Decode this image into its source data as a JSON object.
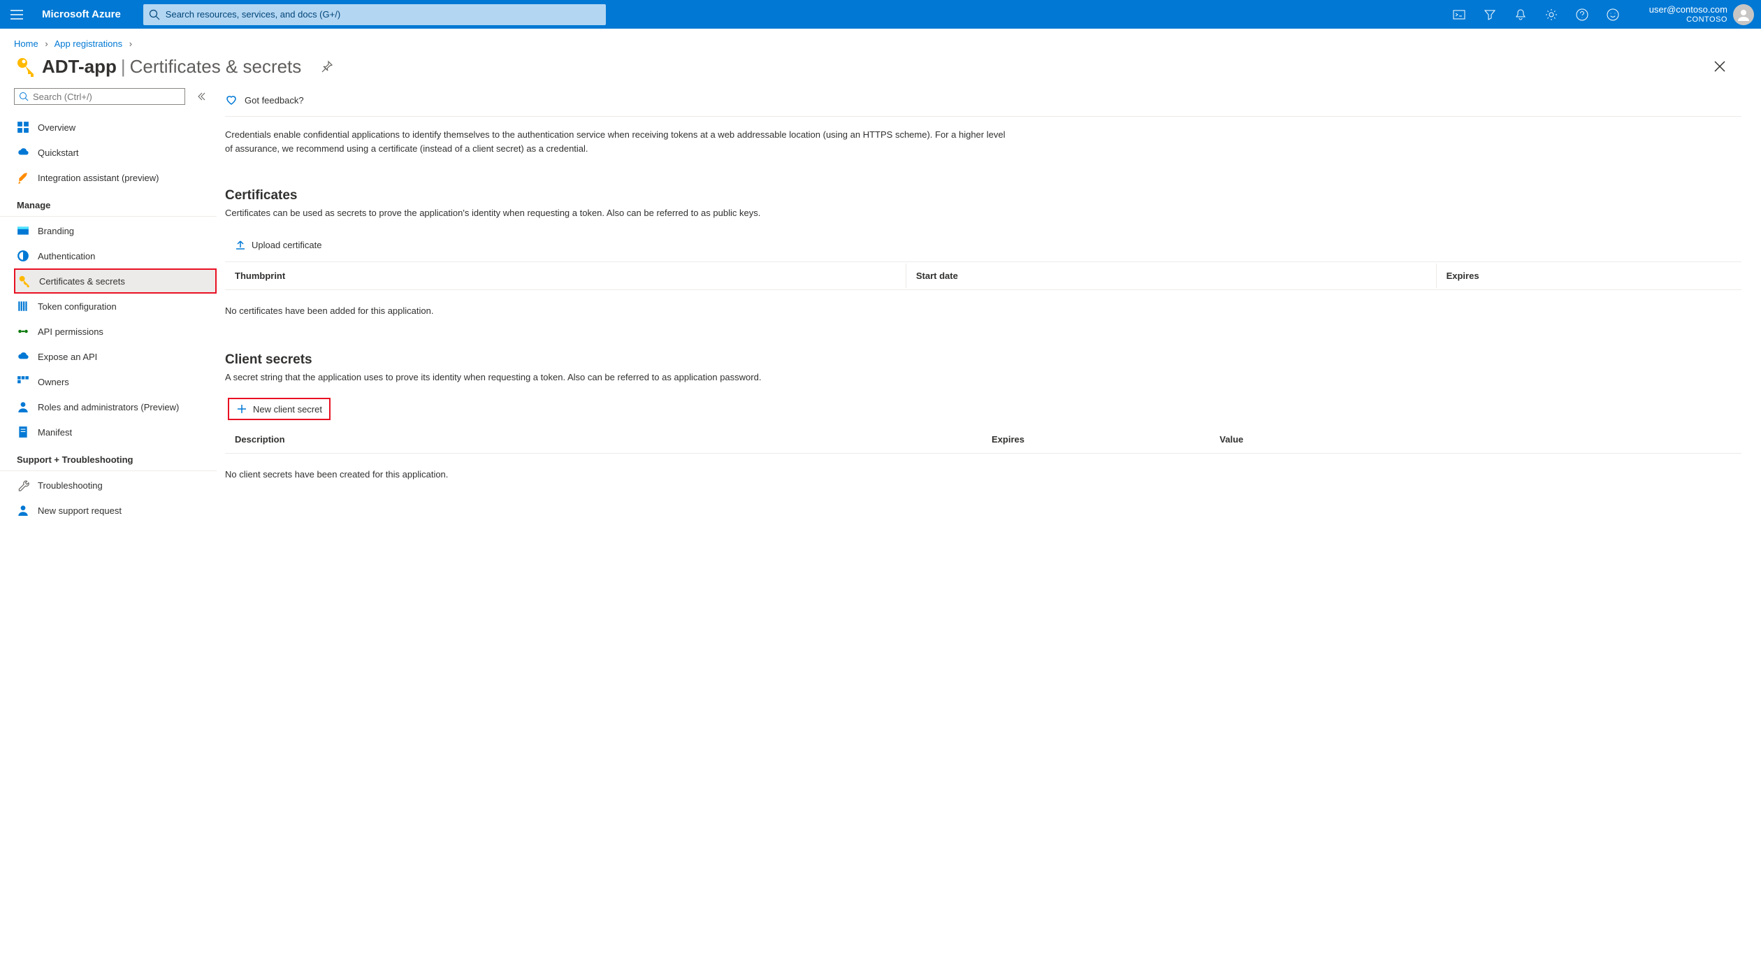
{
  "topbar": {
    "brand": "Microsoft Azure",
    "search_placeholder": "Search resources, services, and docs (G+/)",
    "account_email": "user@contoso.com",
    "account_directory": "CONTOSO"
  },
  "breadcrumb": {
    "items": [
      "Home",
      "App registrations"
    ]
  },
  "page": {
    "title": "ADT-app",
    "subtitle": "Certificates & secrets"
  },
  "sidebar": {
    "search_placeholder": "Search (Ctrl+/)",
    "items_top": [
      {
        "label": "Overview"
      },
      {
        "label": "Quickstart"
      },
      {
        "label": "Integration assistant (preview)"
      }
    ],
    "group_manage": "Manage",
    "items_manage": [
      {
        "label": "Branding"
      },
      {
        "label": "Authentication"
      },
      {
        "label": "Certificates & secrets"
      },
      {
        "label": "Token configuration"
      },
      {
        "label": "API permissions"
      },
      {
        "label": "Expose an API"
      },
      {
        "label": "Owners"
      },
      {
        "label": "Roles and administrators (Preview)"
      },
      {
        "label": "Manifest"
      }
    ],
    "group_support": "Support + Troubleshooting",
    "items_support": [
      {
        "label": "Troubleshooting"
      },
      {
        "label": "New support request"
      }
    ]
  },
  "main": {
    "feedback": "Got feedback?",
    "intro": "Credentials enable confidential applications to identify themselves to the authentication service when receiving tokens at a web addressable location (using an HTTPS scheme). For a higher level of assurance, we recommend using a certificate (instead of a client secret) as a credential.",
    "certificates": {
      "title": "Certificates",
      "desc": "Certificates can be used as secrets to prove the application's identity when requesting a token. Also can be referred to as public keys.",
      "upload_btn": "Upload certificate",
      "columns": [
        "Thumbprint",
        "Start date",
        "Expires"
      ],
      "empty": "No certificates have been added for this application."
    },
    "secrets": {
      "title": "Client secrets",
      "desc": "A secret string that the application uses to prove its identity when requesting a token. Also can be referred to as application password.",
      "new_btn": "New client secret",
      "columns": [
        "Description",
        "Expires",
        "Value"
      ],
      "empty": "No client secrets have been created for this application."
    }
  }
}
